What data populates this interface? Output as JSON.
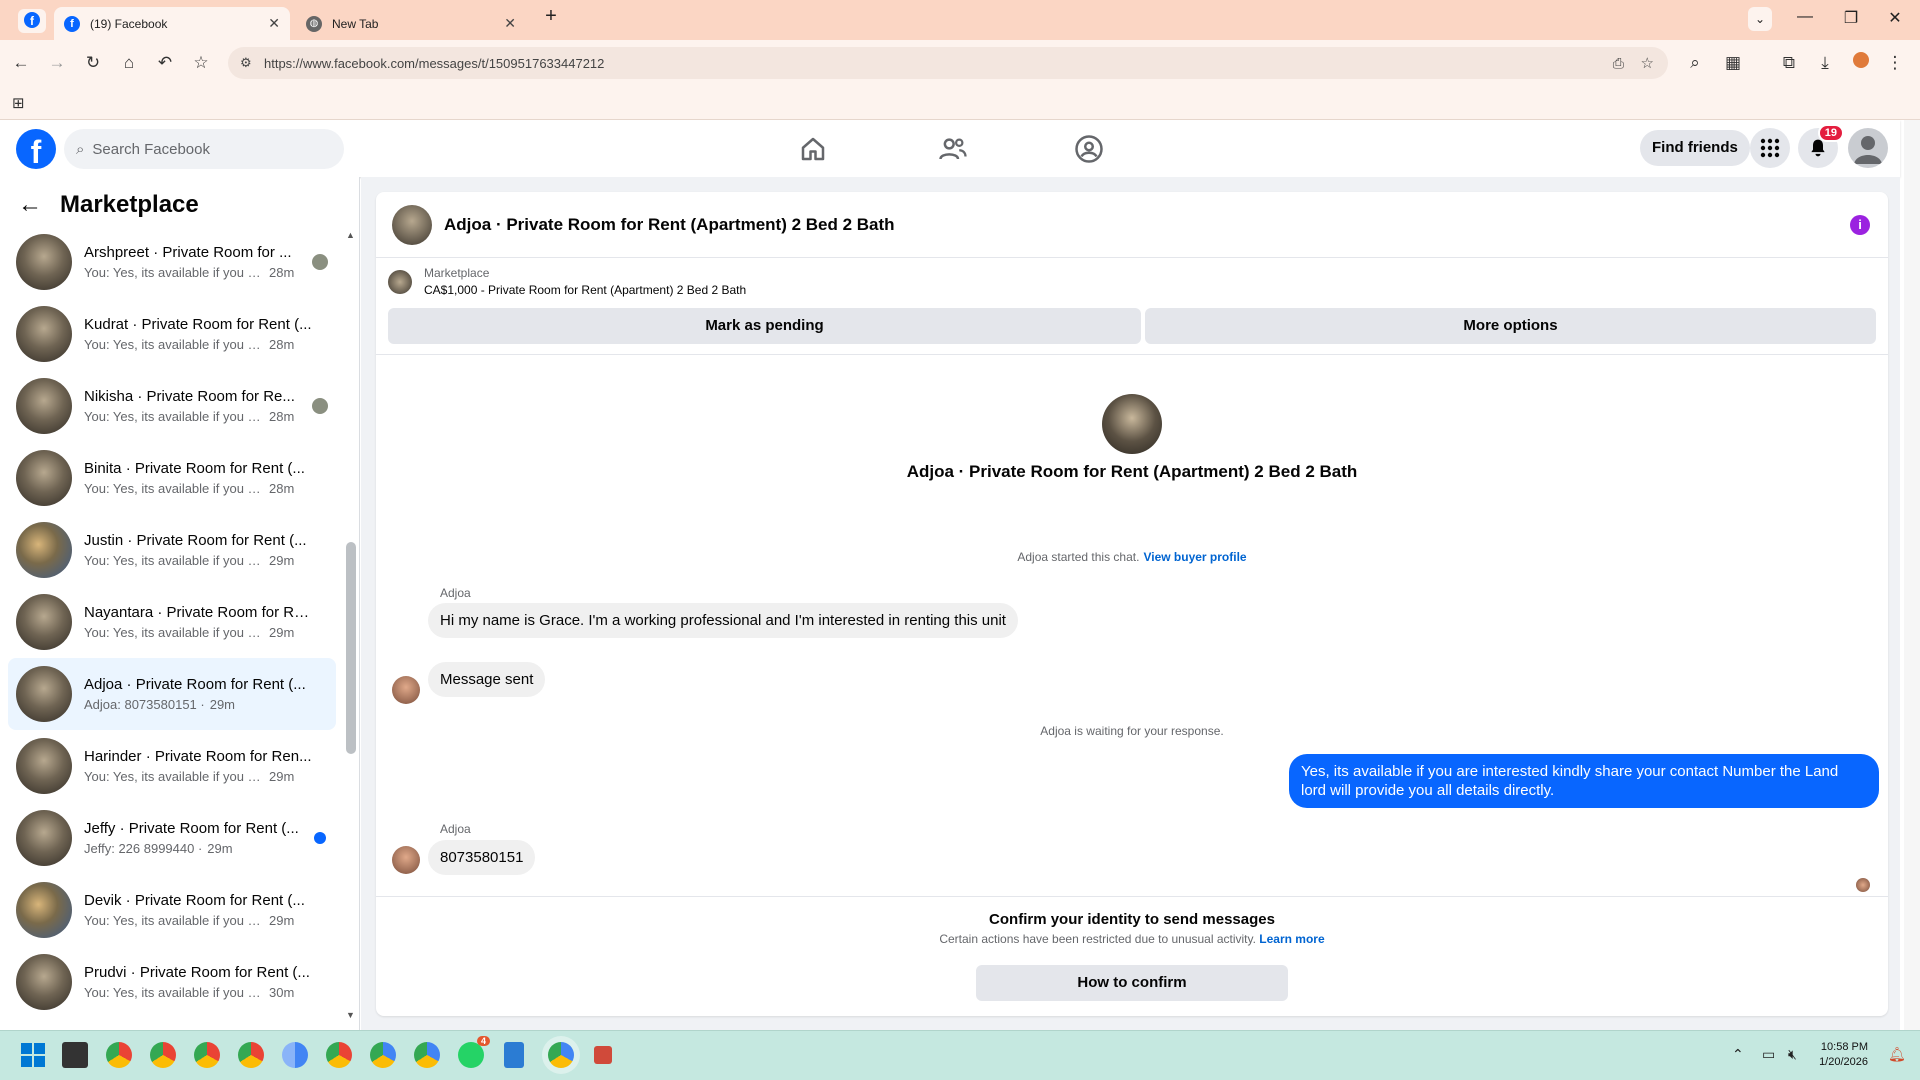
{
  "browser": {
    "tabs": [
      {
        "title": "(19) Facebook",
        "icon": "facebook-icon"
      },
      {
        "title": "New Tab",
        "icon": "globe-icon"
      }
    ],
    "url": "https://www.facebook.com/messages/t/1509517633447212"
  },
  "header": {
    "search_placeholder": "Search Facebook",
    "find_friends": "Find friends",
    "notification_count": "19"
  },
  "sidebar": {
    "title": "Marketplace",
    "conversations": [
      {
        "name": "Arshpreet · Private Room for ...",
        "preview": "You: Yes, its available if you ar...",
        "time": "28m",
        "indicator": "avatar"
      },
      {
        "name": "Kudrat · Private Room for Rent (...",
        "preview": "You: Yes, its available if you are in...",
        "time": "28m",
        "indicator": "none"
      },
      {
        "name": "Nikisha · Private Room for Re...",
        "preview": "You: Yes, its available if you ar...",
        "time": "28m",
        "indicator": "avatar"
      },
      {
        "name": "Binita · Private Room for Rent (...",
        "preview": "You: Yes, its available if you are in...",
        "time": "28m",
        "indicator": "none"
      },
      {
        "name": "Justin · Private Room for Rent (...",
        "preview": "You: Yes, its available if you are in...",
        "time": "29m",
        "indicator": "none"
      },
      {
        "name": "Nayantara · Private Room for Re...",
        "preview": "You: Yes, its available if you are in...",
        "time": "29m",
        "indicator": "none"
      },
      {
        "name": "Adjoa · Private Room for Rent (...",
        "preview": "Adjoa: 8073580151 ·",
        "time": "29m",
        "indicator": "none",
        "active": true
      },
      {
        "name": "Harinder · Private Room for Ren...",
        "preview": "You: Yes, its available if you are in...",
        "time": "29m",
        "indicator": "none"
      },
      {
        "name": "Jeffy · Private Room for Rent (...",
        "preview": "Jeffy: 226 8999440 ·",
        "time": "29m",
        "indicator": "unread"
      },
      {
        "name": "Devik · Private Room for Rent (...",
        "preview": "You: Yes, its available if you are in...",
        "time": "29m",
        "indicator": "none"
      },
      {
        "name": "Prudvi · Private Room for Rent (...",
        "preview": "You: Yes, its available if you are in...",
        "time": "30m",
        "indicator": "none"
      }
    ]
  },
  "chat": {
    "title": "Adjoa · Private Room for Rent (Apartment) 2 Bed 2 Bath",
    "listing_source": "Marketplace",
    "listing_price_title": "CA$1,000 - Private Room for Rent (Apartment) 2 Bed 2 Bath",
    "mark_pending": "Mark as pending",
    "more_options": "More options",
    "center_title": "Adjoa · Private Room for Rent (Apartment) 2 Bed 2 Bath",
    "started_text": "Adjoa started this chat.",
    "view_profile": "View buyer profile",
    "sender_name": "Adjoa",
    "msg1": "Hi my name is Grace. I'm a working professional and I'm interested in renting this unit",
    "msg2": "Message sent",
    "waiting_text": "Adjoa is waiting for your response.",
    "msg_out": "Yes, its available if you are interested kindly share your contact Number the Land lord will provide you all details directly.",
    "sender_name2": "Adjoa",
    "msg3": "8073580151",
    "confirm_title": "Confirm your identity to send messages",
    "confirm_sub": "Certain actions have been restricted due to unusual activity.",
    "learn_more": "Learn more",
    "how_to_confirm": "How to confirm"
  },
  "taskbar": {
    "time": "10:58 PM",
    "date": "1/20/2026",
    "whatsapp_badge": "4"
  },
  "colors": {
    "facebook_blue": "#0866ff",
    "tab_bar": "#fbd6c4",
    "taskbar": "#c5e8e0"
  }
}
